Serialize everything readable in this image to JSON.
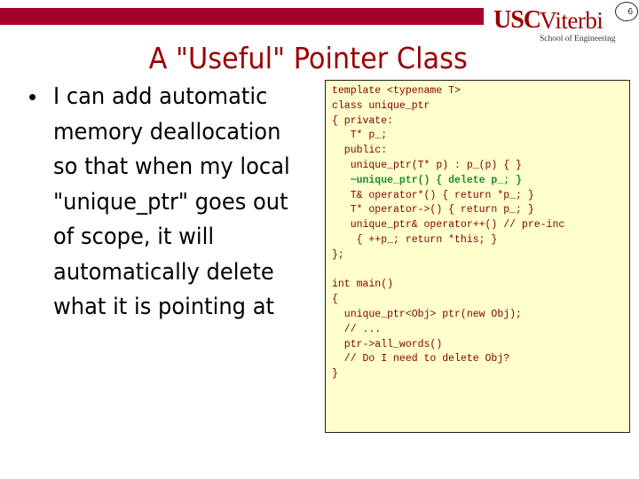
{
  "header": {
    "logo_primary": "USC",
    "logo_secondary": "Viterbi",
    "logo_subtitle": "School of Engineering",
    "page_number": "6",
    "brand_color": "#a3002a"
  },
  "slide": {
    "title": "A \"Useful\" Pointer Class",
    "bullet_lines": [
      "I can add automatic",
      "memory deallocation",
      "so that when my local",
      "\"unique_ptr\" goes out",
      "of scope, it will",
      "automatically delete",
      "what it is pointing at"
    ]
  },
  "code": {
    "background_color": "#ffffcc",
    "text_color": "#800000",
    "highlight_color": "#1a8a3a",
    "lines": [
      "template <typename T>",
      "class unique_ptr",
      "{ private:",
      "   T* p_;",
      "  public:",
      "   unique_ptr(T* p) : p_(p) { }",
      "   ~unique_ptr() { delete p_; }",
      "   T& operator*() { return *p_; }",
      "   T* operator->() { return p_; }",
      "   unique_ptr& operator++() // pre-inc",
      "    { ++p_; return *this; }",
      "};",
      "",
      "int main()",
      "{",
      "  unique_ptr<Obj> ptr(new Obj);",
      "  // ...",
      "  ptr->all_words()",
      "  // Do I need to delete Obj?",
      "}"
    ],
    "highlighted_line_index": 6
  }
}
